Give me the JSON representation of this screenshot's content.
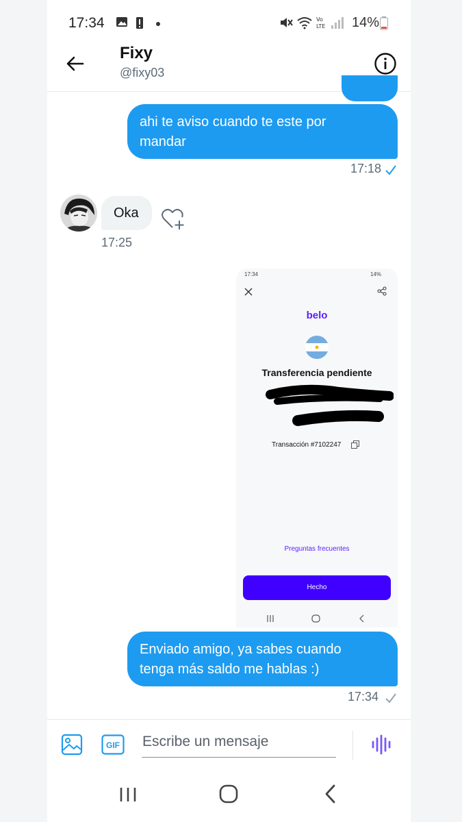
{
  "status_bar": {
    "time": "17:34",
    "battery": "14%"
  },
  "header": {
    "name": "Fixy",
    "handle": "@fixy03"
  },
  "messages": [
    {
      "from": "me",
      "text_line1": "ahi te aviso cuando te este por",
      "text_line2": "mandar",
      "time": "17:18",
      "read": true
    },
    {
      "from": "them",
      "text": "Oka",
      "time": "17:25"
    },
    {
      "from": "me",
      "type": "image",
      "image": {
        "status_time": "17:34",
        "battery": "14%",
        "brand": "belo",
        "title": "Transferencia pendiente",
        "transaction": "Transacción #7102247",
        "faq": "Preguntas frecuentes",
        "button": "Hecho"
      }
    },
    {
      "from": "me",
      "text_line1": "Enviado amigo, ya sabes cuando",
      "text_line2": "tenga más saldo me hablas :)",
      "time": "17:34",
      "read": false
    }
  ],
  "composer": {
    "placeholder": "Escribe un mensaje",
    "gif_label": "GIF"
  },
  "colors": {
    "accent": "#1d9bf0",
    "belo_purple": "#4000ff",
    "voice_purple": "#7856ff"
  },
  "icons": [
    "back-arrow-icon",
    "info-icon",
    "heart-plus-icon",
    "image-icon",
    "gif-icon",
    "voice-icon",
    "recent-apps-icon",
    "home-icon",
    "nav-back-icon"
  ]
}
